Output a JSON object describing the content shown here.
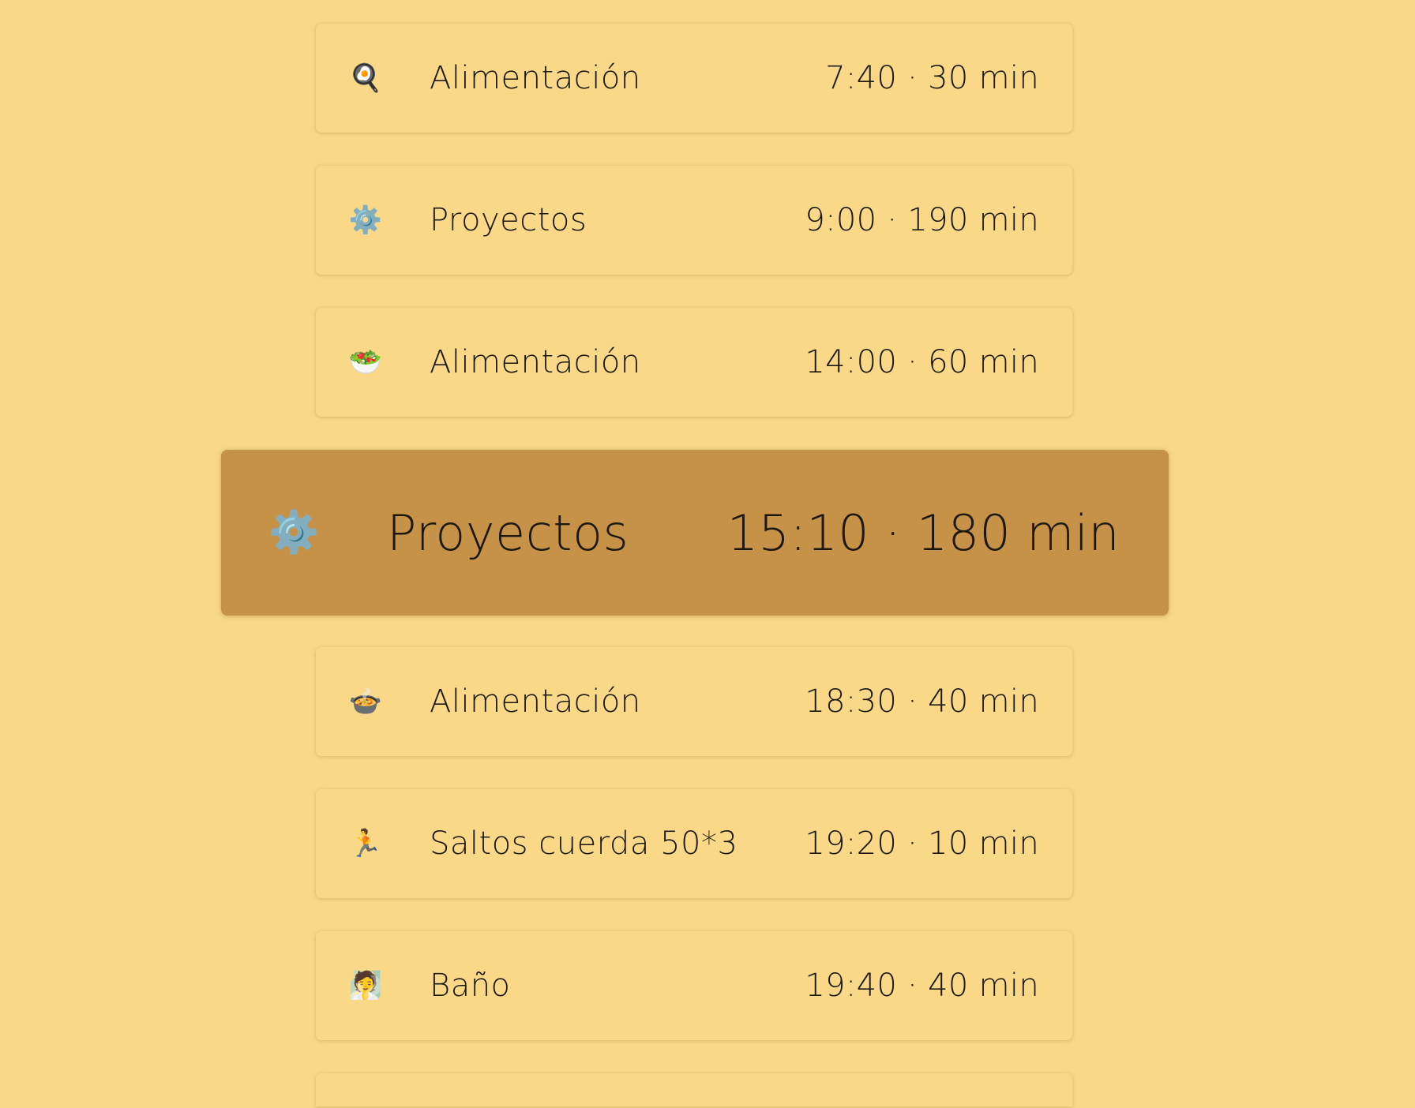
{
  "colors": {
    "background": "#f9d987",
    "card": "#f9d987",
    "active_card": "#c59248",
    "text": "#1c1810"
  },
  "schedule": {
    "items": [
      {
        "icon": "frying-pan-egg-icon",
        "glyph": "🍳",
        "label": "Alimentación",
        "time": "7:40 · 30 min",
        "active": false
      },
      {
        "icon": "gear-icon",
        "glyph": "⚙️",
        "label": "Proyectos",
        "time": "9:00 · 190 min",
        "active": false
      },
      {
        "icon": "salad-icon",
        "glyph": "🥗",
        "label": "Alimentación",
        "time": "14:00 · 60 min",
        "active": false
      },
      {
        "icon": "gear-icon",
        "glyph": "⚙️",
        "label": "Proyectos",
        "time": "15:10 · 180 min",
        "active": true
      },
      {
        "icon": "stew-bowl-icon",
        "glyph": "🍲",
        "label": "Alimentación",
        "time": "18:30 · 40 min",
        "active": false
      },
      {
        "icon": "running-person-icon",
        "glyph": "🏃",
        "label": "Saltos cuerda 50*3",
        "time": "19:20 · 10 min",
        "active": false
      },
      {
        "icon": "person-in-steamy-room-icon",
        "glyph": "🧖",
        "label": "Baño",
        "time": "19:40 · 40 min",
        "active": false
      },
      {
        "icon": "",
        "glyph": "",
        "label": "",
        "time": "",
        "active": false
      }
    ]
  }
}
